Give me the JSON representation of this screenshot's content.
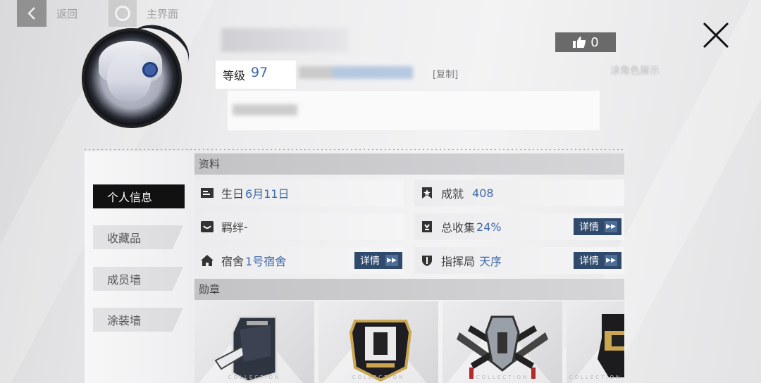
{
  "nav": {
    "back_label": "返回",
    "home_label": "主界面"
  },
  "player": {
    "level_label": "等级",
    "level_value": "97",
    "copy_label": "[复制]"
  },
  "likes": {
    "count": "0"
  },
  "faded_right_text": "涂角色展示",
  "tabs": [
    {
      "label": "个人信息",
      "active": true
    },
    {
      "label": "收藏品",
      "active": false
    },
    {
      "label": "成员墙",
      "active": false
    },
    {
      "label": "涂装墙",
      "active": false
    }
  ],
  "profile_section": {
    "title": "资料",
    "birthday": {
      "label": "生日",
      "value": "6月11日",
      "icon": "calendar-card-icon"
    },
    "achievement": {
      "label": "成就",
      "value": "408",
      "icon": "bookmark-icon"
    },
    "bond": {
      "label": "羁绊",
      "value": "-",
      "icon": "bond-face-icon"
    },
    "collection": {
      "label": "总收集",
      "value": "24%",
      "icon": "collection-icon",
      "detail_label": "详情"
    },
    "dorm": {
      "label": "宿舍",
      "value": "1号宿舍",
      "icon": "home-icon",
      "detail_label": "详情"
    },
    "command": {
      "label": "指挥局",
      "value": "天序",
      "icon": "shield-icon",
      "detail_label": "详情"
    }
  },
  "medal_section": {
    "title": "勋章",
    "watermark": "COLLECTION",
    "medals": [
      {
        "name": "medal-dark-wing-icon"
      },
      {
        "name": "medal-gold-crest-icon"
      },
      {
        "name": "medal-crossed-blades-icon"
      },
      {
        "name": "medal-partial-icon"
      }
    ]
  },
  "colors": {
    "accent_blue": "#3f6aa8",
    "active_tab": "#111111",
    "detail_button": "#2f4a6c"
  }
}
